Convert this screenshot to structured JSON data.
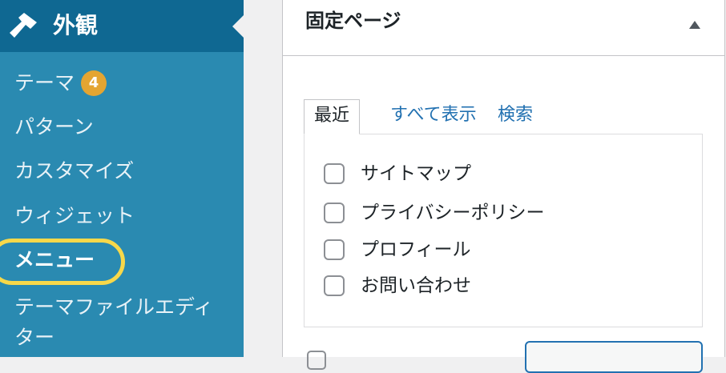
{
  "sidebar": {
    "header": {
      "label": "外観",
      "icon": "paintbrush-icon"
    },
    "items": [
      {
        "label": "テーマ",
        "badge": "4"
      },
      {
        "label": "パターン"
      },
      {
        "label": "カスタマイズ"
      },
      {
        "label": "ウィジェット"
      },
      {
        "label": "メニュー",
        "current": true
      },
      {
        "label": "テーマファイルエディター"
      }
    ]
  },
  "panel": {
    "title": "固定ページ",
    "tabs": [
      {
        "label": "最近",
        "active": true
      },
      {
        "label": "すべて表示"
      },
      {
        "label": "検索"
      }
    ],
    "pages": [
      {
        "label": "サイトマップ",
        "checked": false
      },
      {
        "label": "プライバシーポリシー",
        "checked": false
      },
      {
        "label": "プロフィール",
        "checked": false
      },
      {
        "label": "お問い合わせ",
        "checked": false
      }
    ]
  },
  "colors": {
    "sidebar_bg": "#2a8ab1",
    "sidebar_header_bg": "#0f6892",
    "badge": "#e4a532",
    "highlight_ring": "#f7d84a",
    "link": "#2271b1"
  }
}
